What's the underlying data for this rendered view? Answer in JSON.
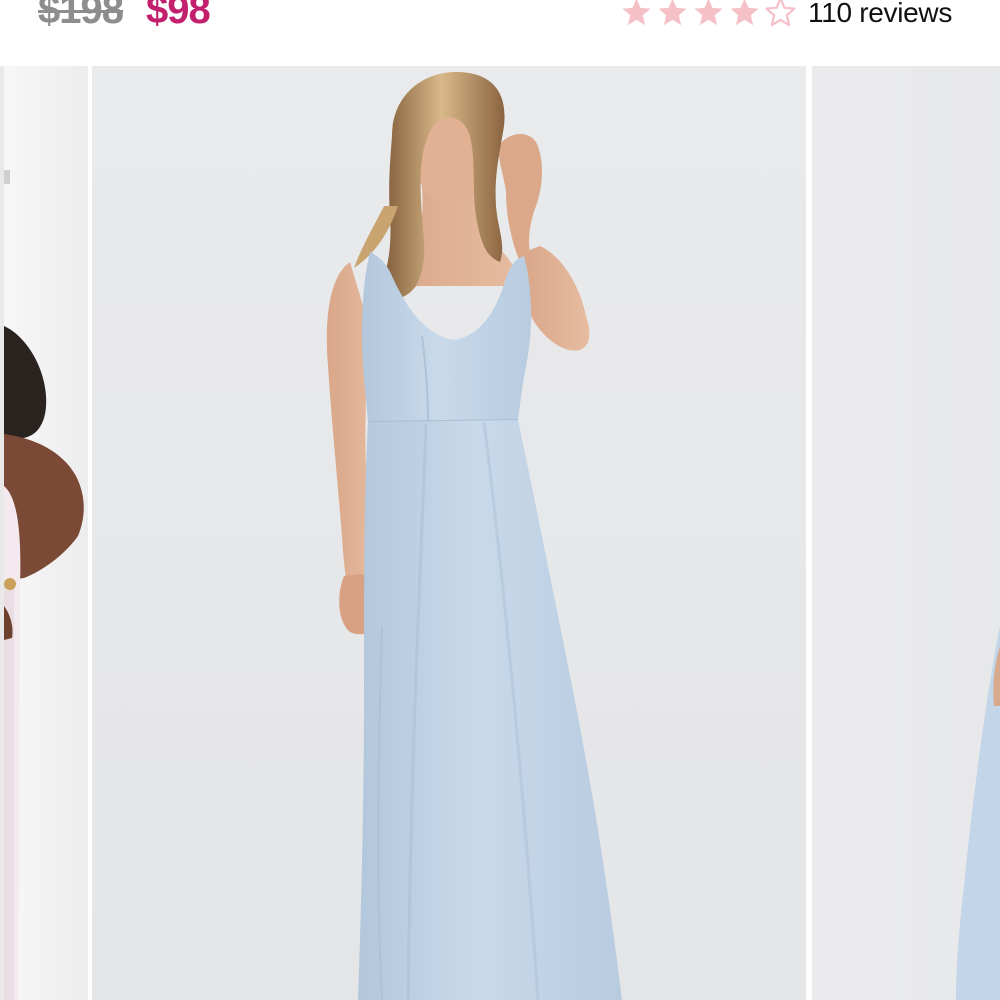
{
  "product": {
    "price_original": "$198",
    "price_sale": "$98",
    "rating": 4,
    "rating_max": 5,
    "reviews_label": "110 reviews"
  },
  "colors": {
    "sale_price": "#c21f6d",
    "original_price": "#8d8d8d",
    "star_filled": "#f5c0c7",
    "star_empty_outline": "#f5c0c7",
    "dress": "#c4d6e8",
    "background": "#e8e9eb"
  },
  "icons": {
    "star": "star-icon",
    "star_outline": "star-outline-icon"
  }
}
